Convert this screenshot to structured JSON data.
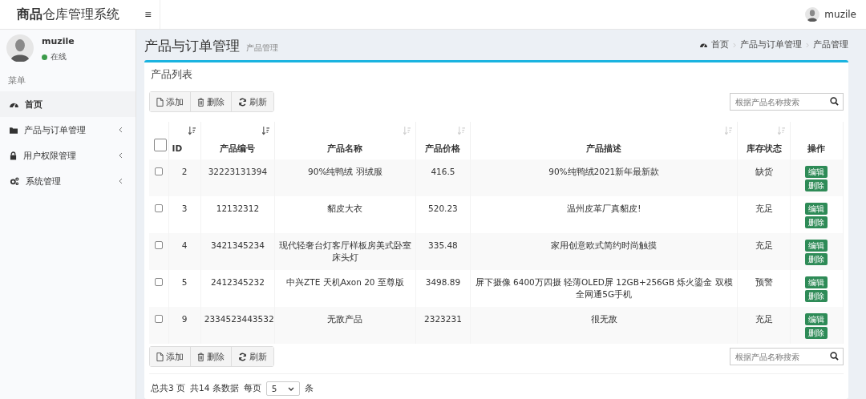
{
  "topbar": {
    "logo_bold": "商品",
    "logo_rest": "仓库管理系统",
    "menu_toggle": "≡",
    "user": "muzile"
  },
  "sidebar": {
    "user": {
      "name": "muzile",
      "status": "在线",
      "online": true
    },
    "menu_label": "菜单",
    "items": [
      {
        "label": "首页",
        "selected": true,
        "expandable": false
      },
      {
        "label": "产品与订单管理",
        "selected": false,
        "expandable": true
      },
      {
        "label": "用户权限管理",
        "selected": false,
        "expandable": true
      },
      {
        "label": "系统管理",
        "selected": false,
        "expandable": true
      }
    ]
  },
  "page": {
    "title": "产品与订单管理",
    "subtitle": "产品管理",
    "breadcrumb": [
      "首页",
      "产品与订单管理",
      "产品管理"
    ]
  },
  "panel": {
    "title": "产品列表",
    "toolbar": [
      {
        "label": "添加"
      },
      {
        "label": "删除"
      },
      {
        "label": "刷新"
      }
    ],
    "search": {
      "placeholder": "根据产品名称搜索"
    },
    "table": {
      "select_all": {
        "checked": false
      },
      "columns": [
        {
          "label": "ID",
          "sort_active": true
        },
        {
          "label": "产品编号",
          "sort_active": true
        },
        {
          "label": "产品名称",
          "sort_active": false
        },
        {
          "label": "产品价格",
          "sort_active": false
        },
        {
          "label": "产品描述",
          "sort_active": false
        },
        {
          "label": "库存状态",
          "sort_active": false
        },
        {
          "label": "操作"
        }
      ],
      "rows": [
        {
          "checked": false,
          "id": "2",
          "code": "32223131394",
          "name": "90%纯鸭绒 羽绒服",
          "price": "416.5",
          "description": "90%纯鸭绒2021新年最新款",
          "stock": "缺货",
          "actions": [
            "编辑",
            "删除"
          ]
        },
        {
          "checked": false,
          "id": "3",
          "code": "12132312",
          "name": "貂皮大衣",
          "price": "520.23",
          "description": "温州皮革厂真貂皮!",
          "stock": "充足",
          "actions": [
            "编辑",
            "删除"
          ]
        },
        {
          "checked": false,
          "id": "4",
          "code": "3421345234",
          "name": "现代轻奢台灯客厅样板房美式卧室床头灯",
          "price": "335.48",
          "description": "家用创意欧式简约时尚触摸",
          "stock": "充足",
          "actions": [
            "编辑",
            "删除"
          ]
        },
        {
          "checked": false,
          "id": "5",
          "code": "2412345232",
          "name": "中兴ZTE 天机Axon 20 至尊版",
          "price": "3498.89",
          "description": "屏下摄像 6400万四摄 轻薄OLED屏 12GB+256GB 烁火鎏金 双模全网通5G手机",
          "stock": "预警",
          "actions": [
            "编辑",
            "删除"
          ]
        },
        {
          "checked": false,
          "id": "9",
          "code": "2334523443532",
          "name": "无敌产品",
          "price": "2323231",
          "description": "很无敌",
          "stock": "充足",
          "actions": [
            "编辑",
            "删除"
          ]
        }
      ]
    },
    "bottom_toolbar": [
      {
        "label": "添加"
      },
      {
        "label": "删除"
      },
      {
        "label": "刷新"
      }
    ],
    "bottom_search": {
      "placeholder": "根据产品名称搜索"
    },
    "pagination": {
      "pages": "总共3 页",
      "total": "共14 条数据",
      "per_page_label": "每页",
      "per_page": "5",
      "unit": "条"
    }
  }
}
